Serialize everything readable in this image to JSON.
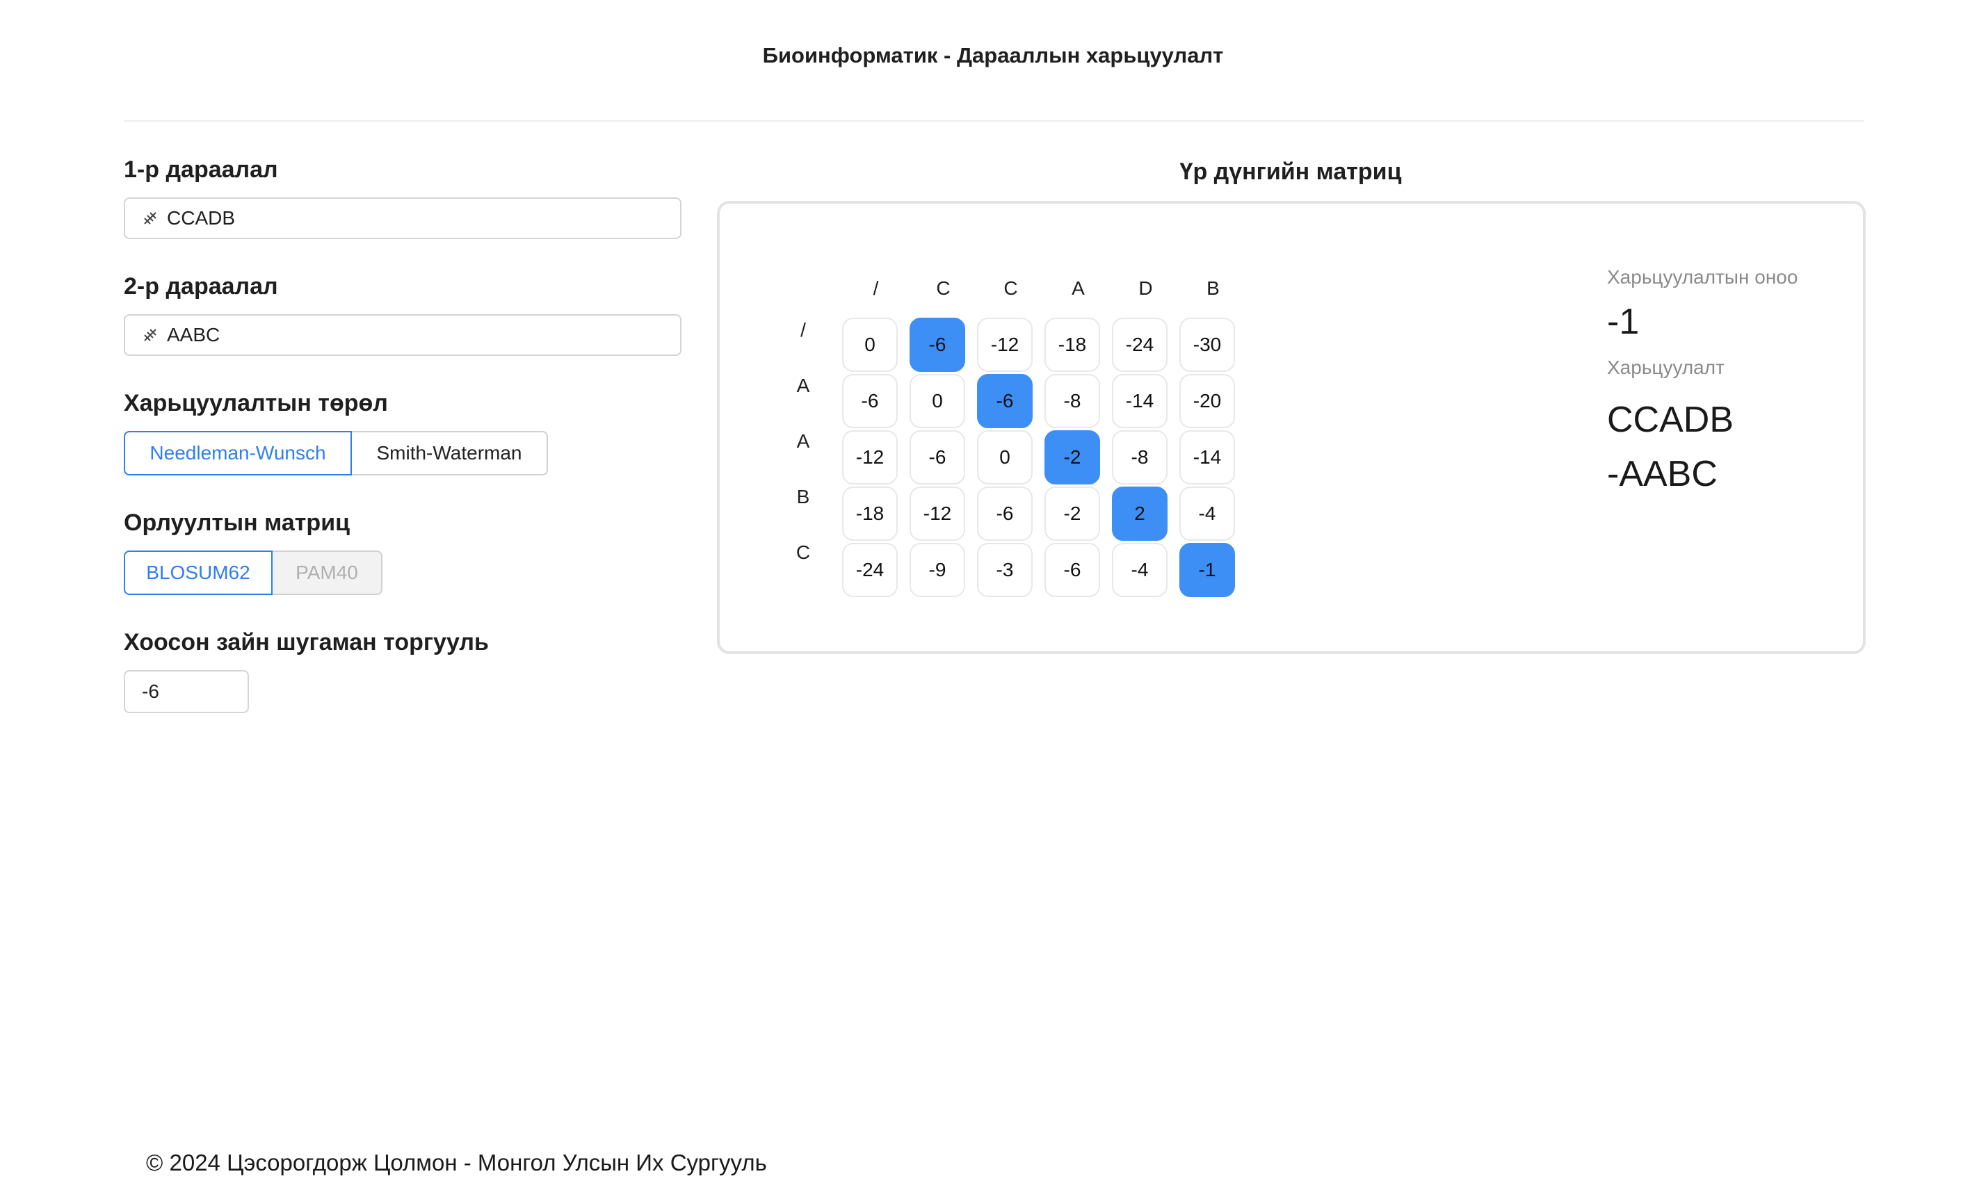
{
  "header": {
    "title": "Биоинформатик - Дарааллын харьцуулалт"
  },
  "form": {
    "seq1": {
      "label": "1-р дараалал",
      "value": "CCADB"
    },
    "seq2": {
      "label": "2-р дараалал",
      "value": "AABC"
    },
    "alignment_type": {
      "label": "Харьцуулалтын төрөл",
      "options": [
        "Needleman-Wunsch",
        "Smith-Waterman"
      ],
      "selected": "Needleman-Wunsch"
    },
    "substitution_matrix": {
      "label": "Орлуултын матриц",
      "options": [
        "BLOSUM62",
        "PAM40"
      ],
      "selected": "BLOSUM62"
    },
    "gap_penalty": {
      "label": "Хоосон зайн шугаман торгууль",
      "value": "-6"
    }
  },
  "matrix": {
    "title": "Үр дүнгийн матриц",
    "col_headers": [
      "/",
      "C",
      "C",
      "A",
      "D",
      "B"
    ],
    "row_headers": [
      "/",
      "A",
      "A",
      "B",
      "C"
    ],
    "cells": [
      [
        "0",
        "-6",
        "-12",
        "-18",
        "-24",
        "-30"
      ],
      [
        "-6",
        "0",
        "-6",
        "-8",
        "-14",
        "-20"
      ],
      [
        "-12",
        "-6",
        "0",
        "-2",
        "-8",
        "-14"
      ],
      [
        "-18",
        "-12",
        "-6",
        "-2",
        "2",
        "-4"
      ],
      [
        "-24",
        "-9",
        "-3",
        "-6",
        "-4",
        "-1"
      ]
    ],
    "path": [
      [
        0,
        1
      ],
      [
        1,
        2
      ],
      [
        2,
        3
      ],
      [
        3,
        4
      ],
      [
        4,
        5
      ]
    ],
    "highlight_color": "#3d8ef5"
  },
  "result": {
    "score_label": "Харьцуулалтын оноо",
    "score": "-1",
    "alignment_label": "Харьцуулалт",
    "alignment_line1": "CCADB",
    "alignment_line2": "-AABC"
  },
  "footer": {
    "text": "© 2024 Цэсорогдорж Цолмон - Монгол Улсын Их Сургууль"
  }
}
